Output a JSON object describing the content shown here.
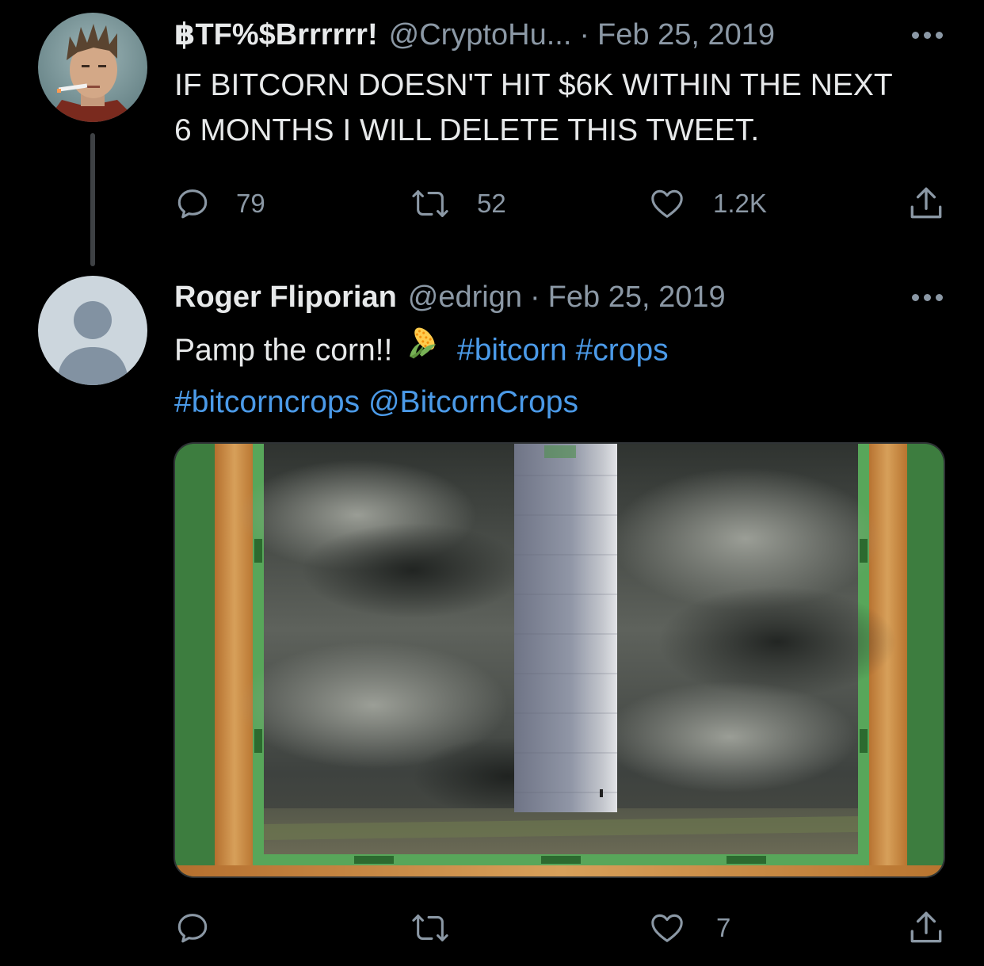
{
  "colors": {
    "background": "#000000",
    "text": "#e7e9ea",
    "muted": "#8b98a5",
    "link": "#4b9ae8",
    "thread_line": "#3e4144"
  },
  "tweets": [
    {
      "avatar": "user-photo-avatar",
      "display_name": "฿TF%$Brrrrrr!",
      "handle": "@CryptoHu...",
      "separator": "·",
      "date": "Feb 25, 2019",
      "text_lines": [
        "IF BITCORN DOESN'T HIT $6K WITHIN THE NEXT",
        "6 MONTHS I WILL DELETE THIS TWEET."
      ],
      "actions": {
        "reply": {
          "icon": "reply-icon",
          "count": "79"
        },
        "retweet": {
          "icon": "retweet-icon",
          "count": "52"
        },
        "like": {
          "icon": "heart-icon",
          "count": "1.2K"
        },
        "share": {
          "icon": "share-icon"
        }
      }
    },
    {
      "avatar": "default-profile-avatar",
      "display_name": "Roger Fliporian",
      "handle": "@edrign",
      "separator": "·",
      "date": "Feb 25, 2019",
      "text": {
        "prefix": "Pamp the corn!!",
        "emoji": "corn-emoji",
        "hashtag_1": "#bitcorn",
        "hashtag_2": "#crops",
        "hashtag_3": "#bitcorncrops",
        "mention": "@BitcornCrops"
      },
      "media": "silo-under-storm-clouds-card-image",
      "actions": {
        "reply": {
          "icon": "reply-icon",
          "count": ""
        },
        "retweet": {
          "icon": "retweet-icon",
          "count": ""
        },
        "like": {
          "icon": "heart-icon",
          "count": "7"
        },
        "share": {
          "icon": "share-icon"
        }
      }
    }
  ]
}
